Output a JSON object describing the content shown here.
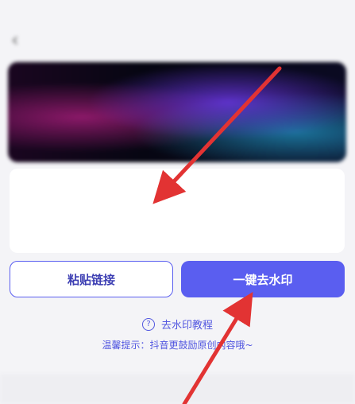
{
  "status_bar": {
    "time": "",
    "indicators": ""
  },
  "header": {
    "title": "",
    "back_icon": "chevron-left-icon"
  },
  "banner": {
    "title": "",
    "subtitle": ""
  },
  "input": {
    "placeholder": ""
  },
  "buttons": {
    "paste_label": "粘贴链接",
    "remove_label": "一键去水印"
  },
  "tutorial": {
    "label": "去水印教程",
    "icon": "question-circle-icon"
  },
  "tip": "温馨提示：抖音更鼓励原创内容哦~",
  "colors": {
    "accent": "#5a5ef0",
    "annotation_arrow": "#e23333",
    "background": "#f4f4f7"
  }
}
